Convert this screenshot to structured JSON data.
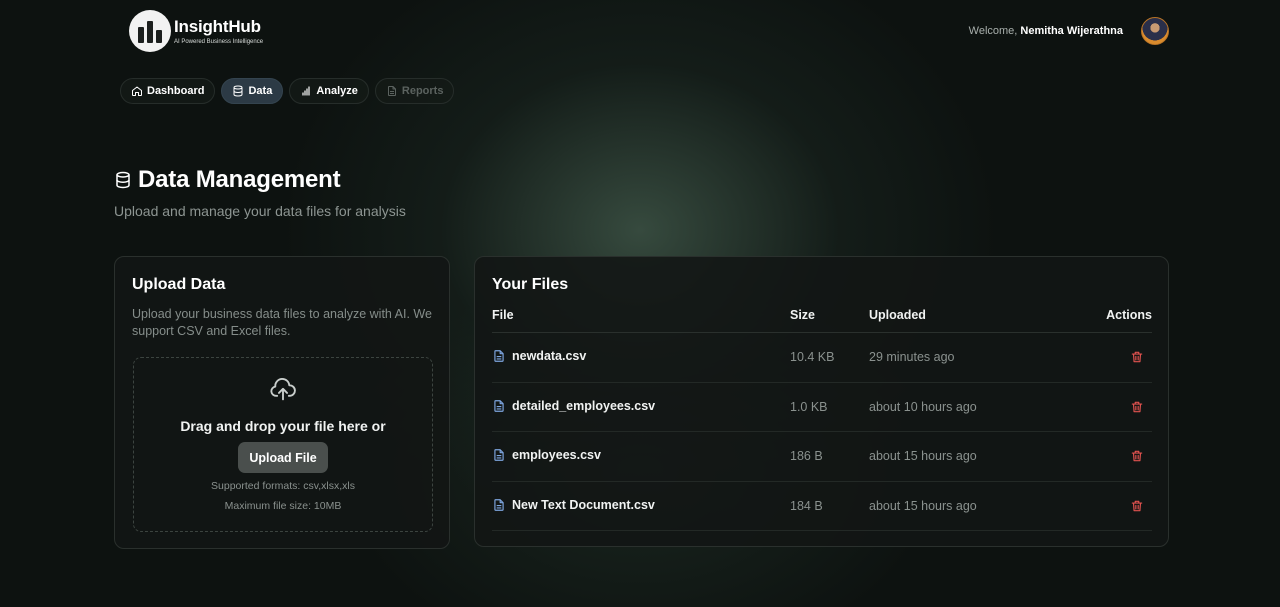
{
  "header": {
    "brand": "InsightHub",
    "tagline": "AI Powered Business Intelligence",
    "welcome_prefix": "Welcome,",
    "user_name": "Nemitha Wijerathna"
  },
  "nav": {
    "items": [
      {
        "label": "Dashboard",
        "icon": "home-icon",
        "state": "normal"
      },
      {
        "label": "Data",
        "icon": "database-icon",
        "state": "active"
      },
      {
        "label": "Analyze",
        "icon": "bar-chart-icon",
        "state": "normal"
      },
      {
        "label": "Reports",
        "icon": "document-icon",
        "state": "disabled"
      }
    ]
  },
  "page": {
    "title": "Data Management",
    "subtitle": "Upload and manage your data files for analysis"
  },
  "upload": {
    "title": "Upload Data",
    "description": "Upload your business data files to analyze with AI. We support CSV and Excel files.",
    "drop_text": "Drag and drop your file here or",
    "button_label": "Upload File",
    "formats": "Supported formats: csv,xlsx,xls",
    "max_size": "Maximum file size: 10MB"
  },
  "files": {
    "title": "Your Files",
    "columns": {
      "file": "File",
      "size": "Size",
      "uploaded": "Uploaded",
      "actions": "Actions"
    },
    "rows": [
      {
        "name": "newdata.csv",
        "size": "10.4 KB",
        "uploaded": "29 minutes ago"
      },
      {
        "name": "detailed_employees.csv",
        "size": "1.0 KB",
        "uploaded": "about 10 hours ago"
      },
      {
        "name": "employees.csv",
        "size": "186 B",
        "uploaded": "about 15 hours ago"
      },
      {
        "name": "New Text Document.csv",
        "size": "184 B",
        "uploaded": "about 15 hours ago"
      }
    ]
  },
  "colors": {
    "background": "#0d1210",
    "accent_file_icon": "#7ea6e0",
    "delete_icon": "#e0524f",
    "active_nav": "#2c3a45"
  }
}
